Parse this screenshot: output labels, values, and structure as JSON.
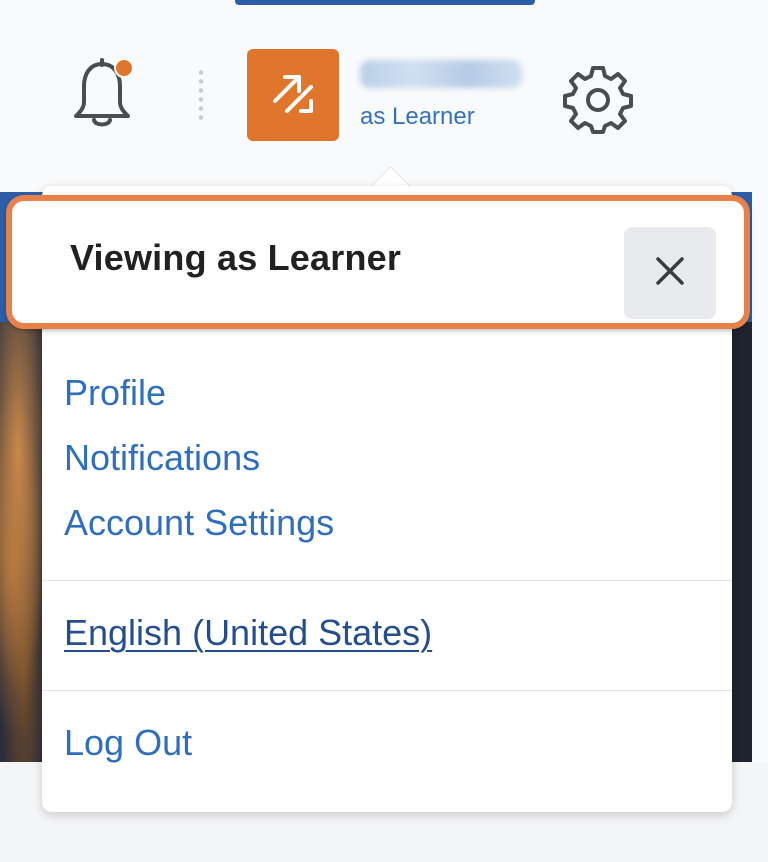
{
  "header": {
    "user_name": "",
    "role_label": "as Learner"
  },
  "icons": {
    "notifications": "bell-icon",
    "role_switch": "switch-arrows-icon",
    "settings": "gear-icon",
    "close": "close-icon"
  },
  "viewing_panel": {
    "title": "Viewing as Learner"
  },
  "menu": {
    "profile": "Profile",
    "notifications": "Notifications",
    "account_settings": "Account Settings",
    "language": "English (United States)",
    "logout": "Log Out"
  },
  "colors": {
    "accent_orange": "#e0762c",
    "highlight_border": "#e7814a",
    "link_blue": "#2f6fbe",
    "brand_blue": "#2c5ea8"
  }
}
